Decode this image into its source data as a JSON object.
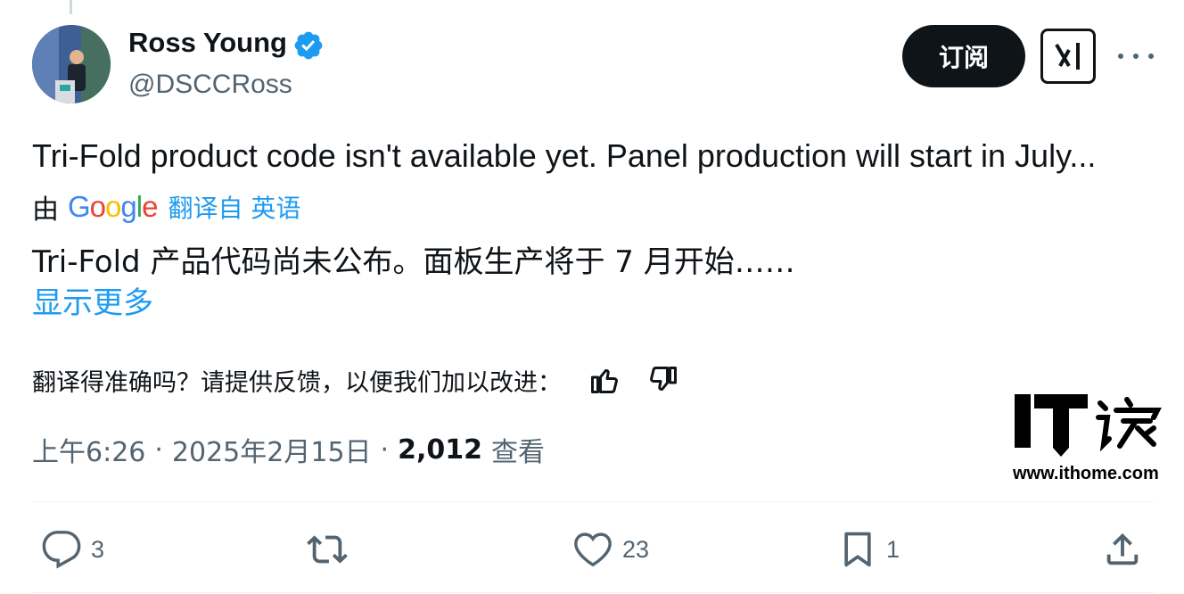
{
  "author": {
    "display_name": "Ross Young",
    "handle": "@DSCCRoss",
    "verified": true
  },
  "header": {
    "subscribe_label": "订阅",
    "grok_icon": "grok-icon",
    "more_icon": "more-icon"
  },
  "tweet": {
    "text": "Tri-Fold product code isn't available yet. Panel production will start in July...",
    "translated_by_prefix": "由",
    "translator": "Google",
    "translate_link": "翻译自 英语",
    "translated_text": "Tri-Fold 产品代码尚未公布。面板生产将于 7 月开始……",
    "show_more": "显示更多"
  },
  "feedback": {
    "prompt": "翻译得准确吗？请提供反馈，以便我们加以改进：",
    "like_icon": "thumbs-up-icon",
    "dislike_icon": "thumbs-down-icon"
  },
  "meta": {
    "time": "上午6:26",
    "separator": "·",
    "date": "2025年2月15日",
    "views_count": "2,012",
    "views_label": "查看"
  },
  "watermark": {
    "url": "www.ithome.com"
  },
  "actions": {
    "replies": "3",
    "reposts": "",
    "likes": "23",
    "bookmarks": "1"
  },
  "colors": {
    "accent": "#1d9bf0",
    "text": "#0f1419",
    "secondary": "#536471",
    "google_blue": "#4285F4",
    "google_red": "#EA4335",
    "google_yellow": "#FBBC05",
    "google_green": "#34A853"
  }
}
